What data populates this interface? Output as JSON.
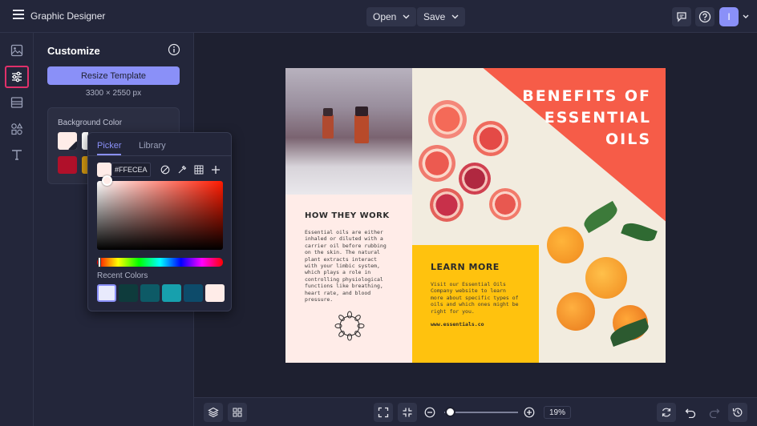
{
  "app": {
    "title": "Graphic Designer"
  },
  "header": {
    "open_label": "Open",
    "save_label": "Save",
    "avatar_letter": "I"
  },
  "panel": {
    "title": "Customize",
    "resize_label": "Resize Template",
    "dimensions": "3300 × 2550 px",
    "bg_label": "Background Color"
  },
  "picker": {
    "tabs": [
      "Picker",
      "Library"
    ],
    "hex_value": "#FFECEA",
    "recent_label": "Recent Colors",
    "recent_colors": [
      "#e8eafc",
      "#0e3b3c",
      "#0d5a66",
      "#17a0ad",
      "#0d4b6a",
      "#ffece8"
    ]
  },
  "colors": {
    "accent": "#8a90f8",
    "highlight": "#e0306a",
    "bg_swatch_1": "#ffece8",
    "bg_swatch_red": "#b0102a",
    "bg_swatch_gold": "#d69a12"
  },
  "brochure": {
    "headline_1": "BENEFITS OF",
    "headline_2": "ESSENTIAL",
    "headline_3": "OILS",
    "how_title": "HOW THEY WORK",
    "how_body": "Essential oils are either inhaled or diluted with a carrier oil before rubbing on the skin. The natural plant extracts interact with your limbic system, which plays a role in controlling physiological functions like breathing, heart rate, and blood pressure.",
    "learn_title": "LEARN MORE",
    "learn_body": "Visit our Essential Oils Company website to learn more about specific types of oils and which ones might be right for you.",
    "learn_url": "www.essentials.co"
  },
  "zoom": {
    "value": "19%",
    "level": 0.19
  }
}
